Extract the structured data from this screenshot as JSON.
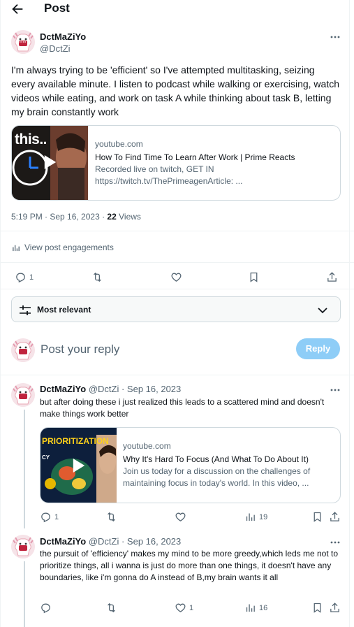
{
  "header": {
    "title": "Post"
  },
  "post": {
    "display_name": "DctMaZiYo",
    "handle": "@DctZi",
    "text": "I'm always trying to be 'efficient' so I've attempted multitasking, seizing every available minute. I listen to podcast while walking or exercising, watch videos while eating, and work on task A while thinking about task B, letting my brain constantly work",
    "card": {
      "thumb_text": "this..",
      "domain": "youtube.com",
      "title": "How To Find Time To Learn After Work | Prime Reacts",
      "description": "Recorded live on twitch, GET IN https://twitch.tv/ThePrimeagenArticle: ..."
    },
    "time": "5:19 PM · Sep 16, 2023 · ",
    "views_count": "22",
    "views_label": " Views",
    "engagements_label": "View post engagements",
    "actions": {
      "replies": "1"
    }
  },
  "sort": {
    "label": "Most relevant"
  },
  "composer": {
    "placeholder": "Post your reply",
    "button": "Reply"
  },
  "replies": [
    {
      "display_name": "DctMaZiYo",
      "handle": "@DctZi · Sep 16, 2023",
      "text": "but after doing these i just realized this leads to a scattered mind  and doesn't make things work better",
      "card": {
        "thumb_title": "PRIORITIZATION",
        "thumb_sub": "CY",
        "domain": "youtube.com",
        "title": "Why It's Hard To Focus (And What To Do About It)",
        "description": "Join us today for a discussion on the challenges of maintaining focus in today's world. In this video, ..."
      },
      "actions": {
        "replies": "1",
        "likes": "",
        "views": "19"
      }
    },
    {
      "display_name": "DctMaZiYo",
      "handle": "@DctZi · Sep 16, 2023",
      "text": "the pursuit of 'efficiency' makes my mind to be more greedy,which leds me not to prioritize things, all i wanna  is just do more than one things, it doesn't have any boundaries, like i'm gonna do A instead of B,my brain wants it all",
      "actions": {
        "replies": "",
        "likes": "1",
        "views": "16"
      }
    }
  ],
  "colors": {
    "accent": "#1d9bf0",
    "reply_button": "#8ecdf7",
    "muted": "#536471"
  }
}
